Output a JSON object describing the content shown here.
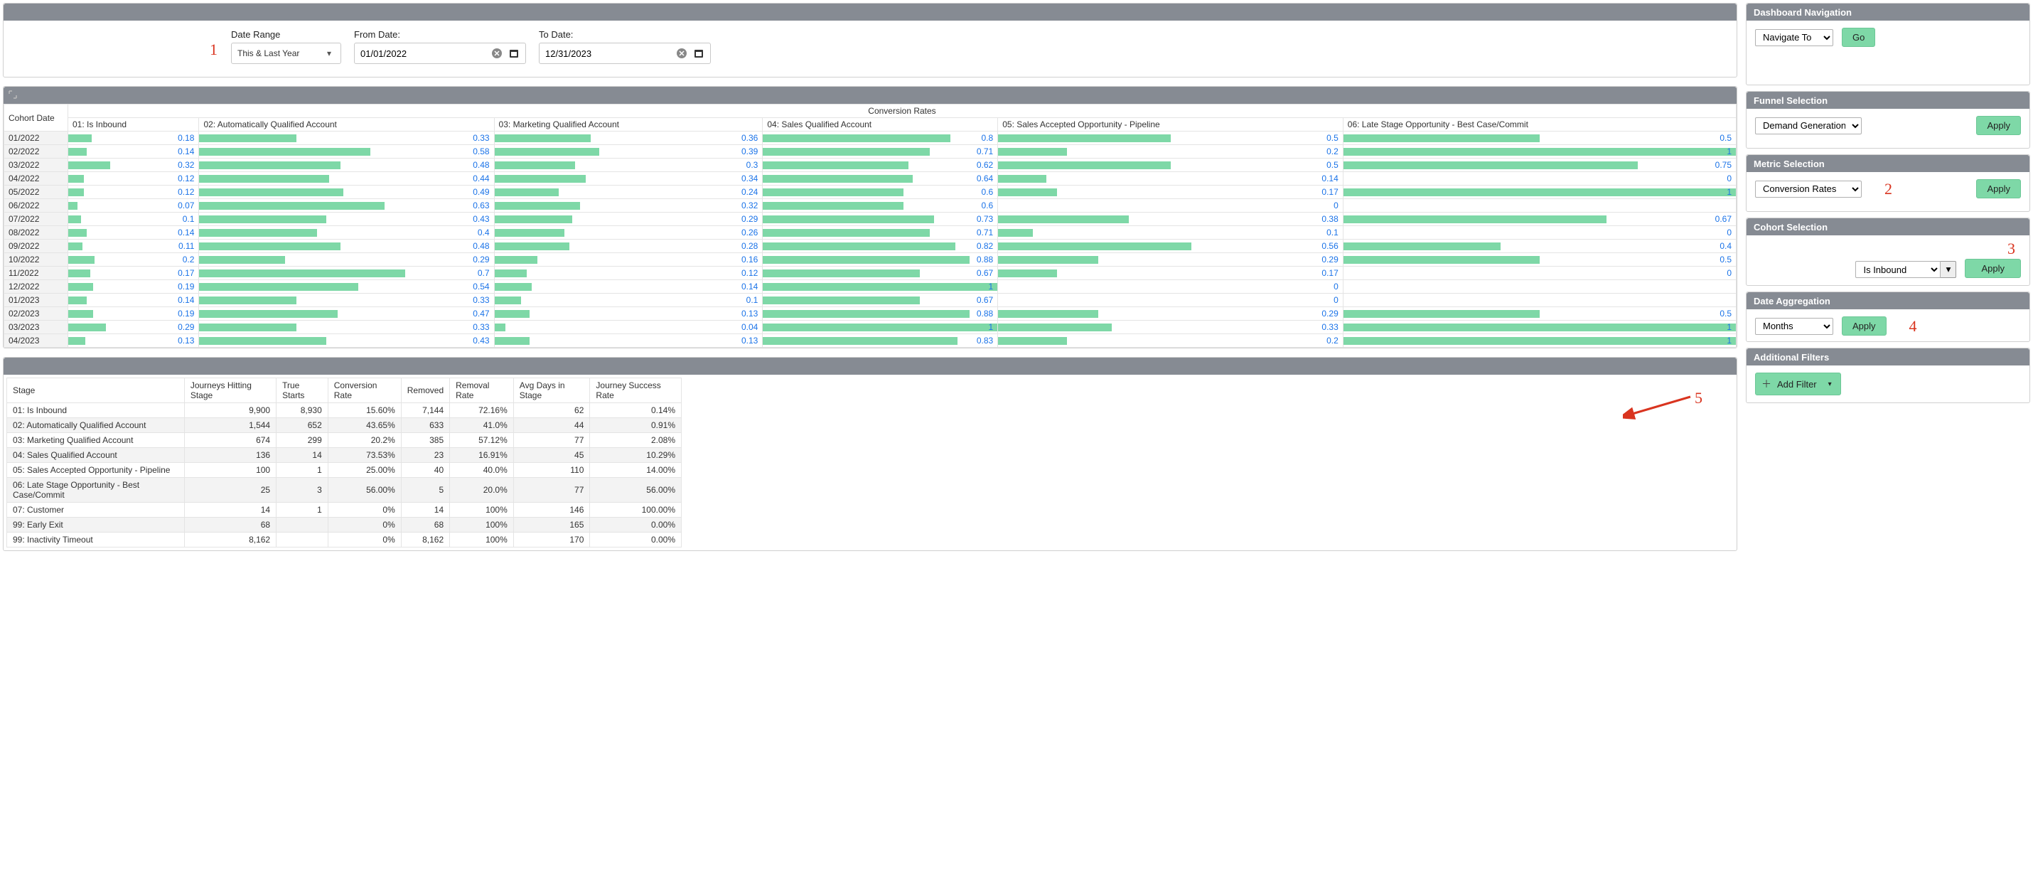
{
  "dateBar": {
    "rangeLabel": "Date Range",
    "rangeValue": "This & Last Year",
    "fromLabel": "From Date:",
    "fromValue": "01/01/2022",
    "toLabel": "To Date:",
    "toValue": "12/31/2023"
  },
  "chart_data": {
    "type": "table",
    "cohortHeader": "Cohort Date",
    "groupHeader": "Conversion Rates",
    "columns": [
      "01: Is Inbound",
      "02: Automatically Qualified Account",
      "03: Marketing Qualified Account",
      "04: Sales Qualified Account",
      "05: Sales Accepted Opportunity - Pipeline",
      "06: Late Stage Opportunity - Best Case/Commit"
    ],
    "rows": [
      {
        "cohort": "01/2022",
        "v": [
          0.18,
          0.33,
          0.36,
          0.8,
          0.5,
          0.5
        ]
      },
      {
        "cohort": "02/2022",
        "v": [
          0.14,
          0.58,
          0.39,
          0.71,
          0.2,
          1
        ]
      },
      {
        "cohort": "03/2022",
        "v": [
          0.32,
          0.48,
          0.3,
          0.62,
          0.5,
          0.75
        ]
      },
      {
        "cohort": "04/2022",
        "v": [
          0.12,
          0.44,
          0.34,
          0.64,
          0.14,
          0
        ]
      },
      {
        "cohort": "05/2022",
        "v": [
          0.12,
          0.49,
          0.24,
          0.6,
          0.17,
          1
        ]
      },
      {
        "cohort": "06/2022",
        "v": [
          0.07,
          0.63,
          0.32,
          0.6,
          0,
          null
        ]
      },
      {
        "cohort": "07/2022",
        "v": [
          0.1,
          0.43,
          0.29,
          0.73,
          0.38,
          0.67
        ]
      },
      {
        "cohort": "08/2022",
        "v": [
          0.14,
          0.4,
          0.26,
          0.71,
          0.1,
          0
        ]
      },
      {
        "cohort": "09/2022",
        "v": [
          0.11,
          0.48,
          0.28,
          0.82,
          0.56,
          0.4
        ]
      },
      {
        "cohort": "10/2022",
        "v": [
          0.2,
          0.29,
          0.16,
          0.88,
          0.29,
          0.5
        ]
      },
      {
        "cohort": "11/2022",
        "v": [
          0.17,
          0.7,
          0.12,
          0.67,
          0.17,
          0
        ]
      },
      {
        "cohort": "12/2022",
        "v": [
          0.19,
          0.54,
          0.14,
          1,
          0,
          null
        ]
      },
      {
        "cohort": "01/2023",
        "v": [
          0.14,
          0.33,
          0.1,
          0.67,
          0,
          null
        ]
      },
      {
        "cohort": "02/2023",
        "v": [
          0.19,
          0.47,
          0.13,
          0.88,
          0.29,
          0.5
        ]
      },
      {
        "cohort": "03/2023",
        "v": [
          0.29,
          0.33,
          0.04,
          1,
          0.33,
          1
        ]
      },
      {
        "cohort": "04/2023",
        "v": [
          0.13,
          0.43,
          0.13,
          0.83,
          0.2,
          1
        ]
      }
    ]
  },
  "stats": {
    "headers": [
      "Stage",
      "Journeys Hitting Stage",
      "True Starts",
      "Conversion Rate",
      "Removed",
      "Removal Rate",
      "Avg Days in Stage",
      "Journey Success Rate"
    ],
    "rows": [
      [
        "01: Is Inbound",
        "9,900",
        "8,930",
        "15.60%",
        "7,144",
        "72.16%",
        "62",
        "0.14%"
      ],
      [
        "02: Automatically Qualified Account",
        "1,544",
        "652",
        "43.65%",
        "633",
        "41.0%",
        "44",
        "0.91%"
      ],
      [
        "03: Marketing Qualified Account",
        "674",
        "299",
        "20.2%",
        "385",
        "57.12%",
        "77",
        "2.08%"
      ],
      [
        "04: Sales Qualified Account",
        "136",
        "14",
        "73.53%",
        "23",
        "16.91%",
        "45",
        "10.29%"
      ],
      [
        "05: Sales Accepted Opportunity - Pipeline",
        "100",
        "1",
        "25.00%",
        "40",
        "40.0%",
        "110",
        "14.00%"
      ],
      [
        "06: Late Stage Opportunity - Best Case/Commit",
        "25",
        "3",
        "56.00%",
        "5",
        "20.0%",
        "77",
        "56.00%"
      ],
      [
        "07: Customer",
        "14",
        "1",
        "0%",
        "14",
        "100%",
        "146",
        "100.00%"
      ],
      [
        "99: Early Exit",
        "68",
        "",
        "0%",
        "68",
        "100%",
        "165",
        "0.00%"
      ],
      [
        "99: Inactivity Timeout",
        "8,162",
        "",
        "0%",
        "8,162",
        "100%",
        "170",
        "0.00%"
      ]
    ]
  },
  "side": {
    "nav": {
      "title": "Dashboard Navigation",
      "placeholder": "Navigate To",
      "btn": "Go"
    },
    "funnel": {
      "title": "Funnel Selection",
      "value": "Demand Generation",
      "btn": "Apply"
    },
    "metric": {
      "title": "Metric Selection",
      "value": "Conversion Rates",
      "btn": "Apply"
    },
    "cohort": {
      "title": "Cohort Selection",
      "value": "Is Inbound",
      "btn": "Apply"
    },
    "agg": {
      "title": "Date Aggregation",
      "value": "Months",
      "btn": "Apply"
    },
    "filters": {
      "title": "Additional Filters",
      "btn": "Add Filter"
    }
  },
  "anno": {
    "n1": "1",
    "n2": "2",
    "n3": "3",
    "n4": "4",
    "n5": "5"
  }
}
